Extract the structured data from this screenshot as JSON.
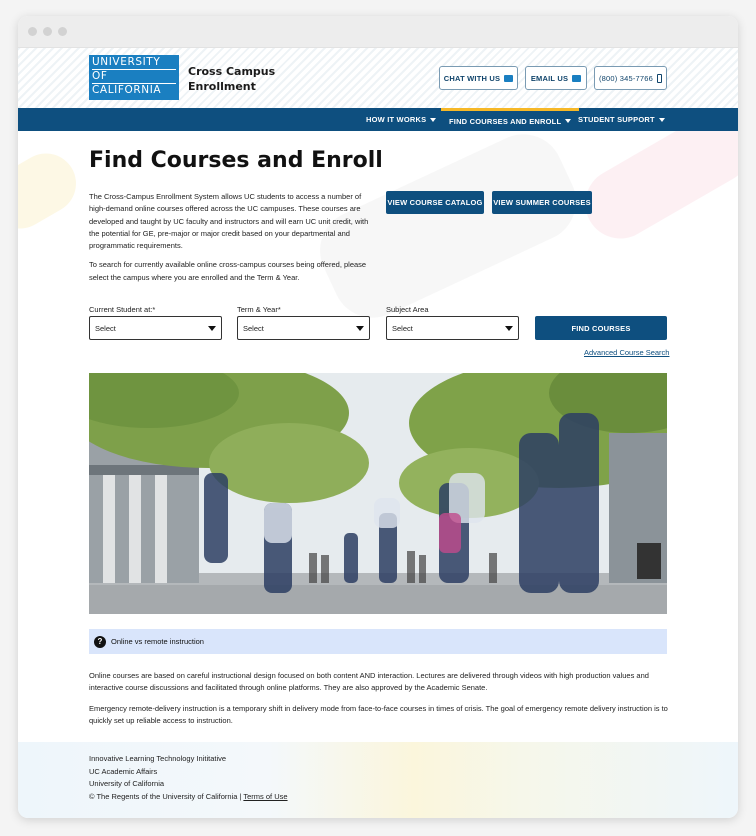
{
  "logo": {
    "line1": "UNIVERSITY",
    "line2": "OF",
    "line3": "CALIFORNIA"
  },
  "site_title": "Cross Campus Enrollment",
  "header_buttons": {
    "chat": "CHAT WITH US",
    "email": "EMAIL US",
    "phone": "(800) 345-7766"
  },
  "nav": {
    "how": "HOW IT WORKS",
    "find": "FIND COURSES AND ENROLL",
    "support": "STUDENT SUPPORT"
  },
  "page_title": "Find Courses and Enroll",
  "intro": {
    "p1": "The Cross-Campus Enrollment System allows UC students to access a number of high-demand online courses offered across the UC campuses. These courses are developed and taught by UC faculty and instructors and will earn UC unit credit, with the potential for GE, pre-major or major credit based on your departmental and programmatic requirements.",
    "p2": "To search for currently available online cross-campus courses being offered, please select the campus where you are enrolled and the Term & Year."
  },
  "catalog_buttons": {
    "catalog": "VIEW COURSE CATALOG",
    "summer": "VIEW SUMMER COURSES"
  },
  "search": {
    "campus_label": "Current Student at:*",
    "term_label": "Term & Year*",
    "subject_label": "Subject Area",
    "select_value": "Select",
    "find_button": "FIND COURSES",
    "advanced_link": "Advanced Course Search"
  },
  "notice": "Online vs remote instruction",
  "body": {
    "p1": "Online courses are based on careful instructional design focused on both content AND interaction. Lectures are delivered through videos with high production values and interactive course discussions and facilitated through online platforms. They are also approved by the Academic Senate.",
    "p2": "Emergency remote-delivery instruction is a temporary shift in delivery mode from face-to-face courses in times of crisis. The goal of emergency remote delivery instruction is to quickly set up reliable access to instruction."
  },
  "footer": {
    "line1": "Innovative Learning Technology Inititative",
    "line2": "UC Academic Affairs",
    "line3": "University of California",
    "copyright": "© The Regents of the University of California",
    "separator": "|",
    "terms": "Terms of Use"
  },
  "colors": {
    "brand_blue": "#0e4f7f",
    "logo_blue": "#1a7fc1",
    "accent_gold": "#f6b828",
    "notice_bg": "#d9e5fb"
  },
  "icons": {
    "chat": "chat-bubble-icon",
    "email": "envelope-icon",
    "phone": "mobile-phone-icon",
    "caret": "caret-down-icon",
    "help": "question-circle-icon"
  }
}
